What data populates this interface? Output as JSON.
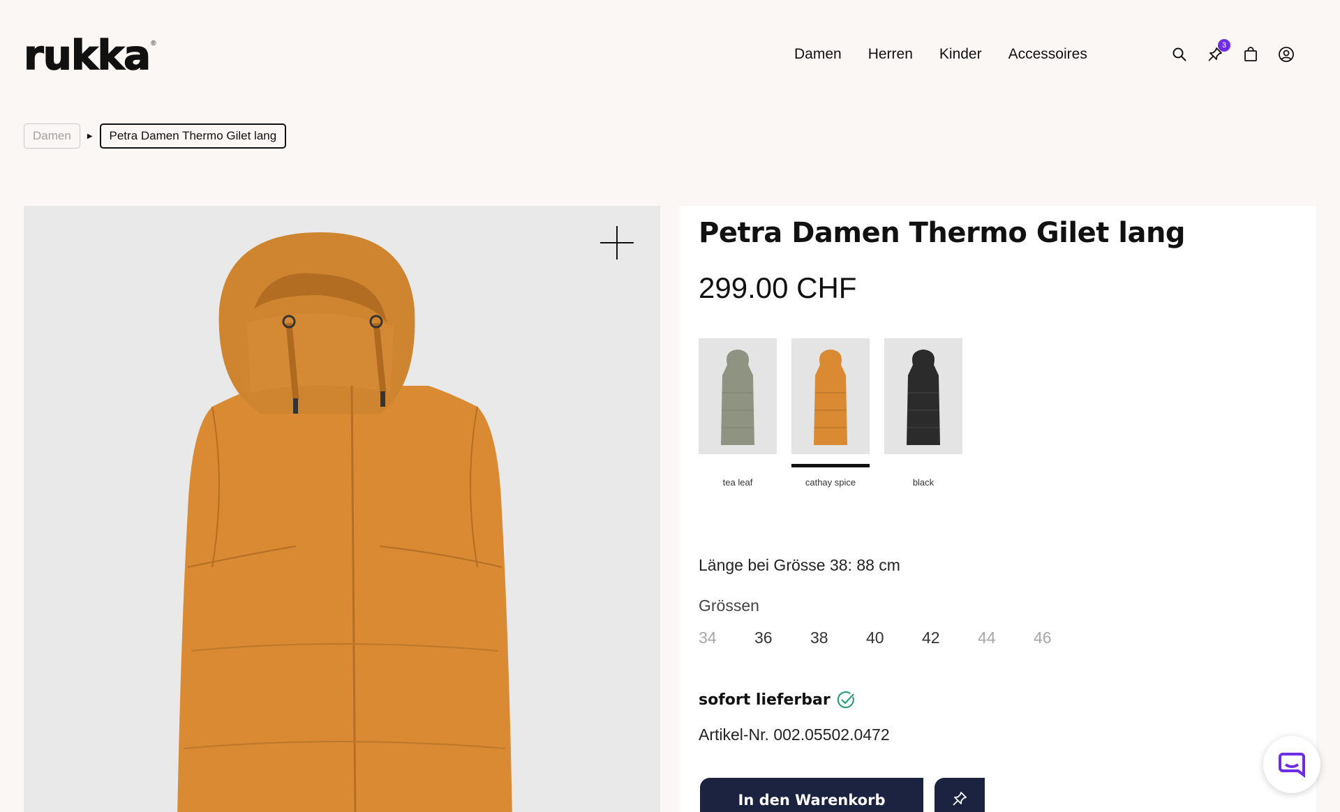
{
  "brand": {
    "logo_text": "rukka",
    "logo_mark": "®"
  },
  "nav": {
    "items": [
      {
        "label": "Damen"
      },
      {
        "label": "Herren"
      },
      {
        "label": "Kinder"
      },
      {
        "label": "Accessoires"
      }
    ]
  },
  "header_icons": {
    "search": "search-icon",
    "wishlist": "pin-icon",
    "wishlist_count": "3",
    "cart": "shopping-bag-icon",
    "account": "user-icon"
  },
  "breadcrumb": {
    "parent": "Damen",
    "current": "Petra Damen Thermo Gilet lang"
  },
  "product": {
    "title": "Petra Damen Thermo Gilet lang",
    "price": "299.00 CHF",
    "colors": [
      {
        "label": "tea leaf",
        "hex": "#8e9382",
        "selected": false
      },
      {
        "label": "cathay spice",
        "hex": "#d98a33",
        "selected": true
      },
      {
        "label": "black",
        "hex": "#2b2b2b",
        "selected": false
      }
    ],
    "length_info": "Länge bei Grösse 38: 88 cm",
    "sizes_label": "Grössen",
    "sizes": [
      {
        "label": "34",
        "available": false
      },
      {
        "label": "36",
        "available": true
      },
      {
        "label": "38",
        "available": true
      },
      {
        "label": "40",
        "available": true
      },
      {
        "label": "42",
        "available": true
      },
      {
        "label": "44",
        "available": false
      },
      {
        "label": "46",
        "available": false
      }
    ],
    "stock_status": "sofort lieferbar",
    "article_number": "Artikel-Nr. 002.05502.0472",
    "add_to_cart_label": "In den Warenkorb"
  },
  "colors": {
    "background": "#faf7f4",
    "image_bg": "#e9e9e9",
    "button": "#1c2340",
    "badge": "#6e2de2",
    "stock_check": "#1a9a6c",
    "product_main": "#d98a33"
  }
}
